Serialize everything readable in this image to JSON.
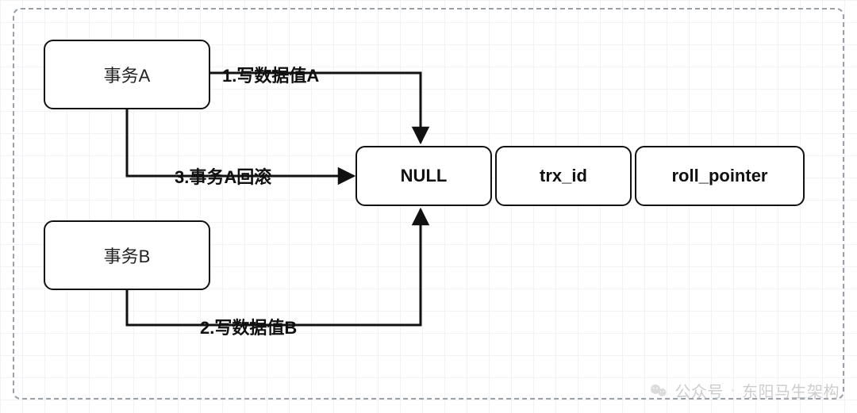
{
  "nodes": {
    "transactionA": {
      "label": "事务A"
    },
    "transactionB": {
      "label": "事务B"
    },
    "row": {
      "cell1": "NULL",
      "cell2": "trx_id",
      "cell3": "roll_pointer"
    }
  },
  "edges": {
    "e1": {
      "label": "1.写数据值A",
      "from": "transactionA",
      "to": "row.cell1"
    },
    "e3": {
      "label": "3.事务A回滚",
      "from": "transactionA",
      "to": "row.cell1"
    },
    "e2": {
      "label": "2.写数据值B",
      "from": "transactionB",
      "to": "row.cell1"
    }
  },
  "watermark": {
    "prefix": "公众号",
    "separator": "·",
    "name": "东阳马生架构"
  }
}
